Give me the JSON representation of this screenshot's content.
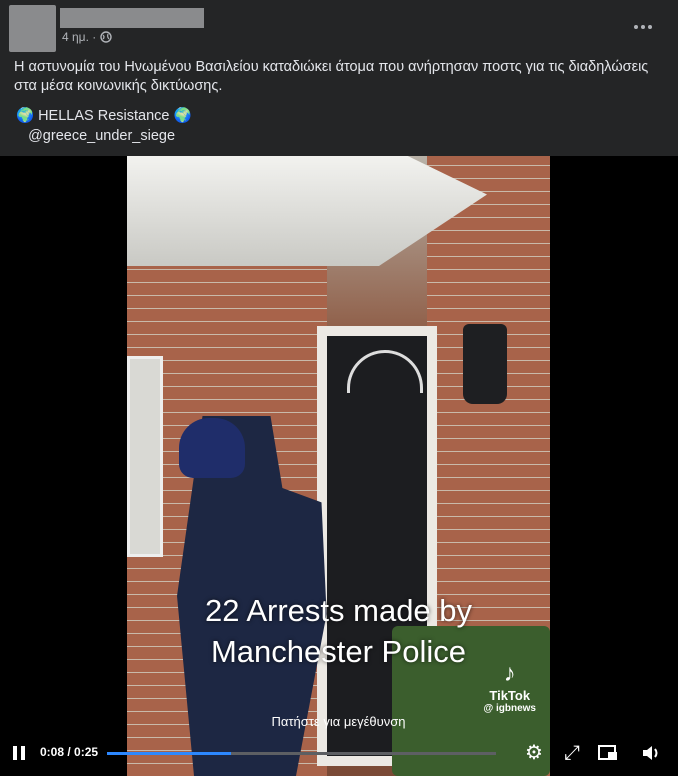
{
  "post": {
    "time": "4 ημ. ·",
    "text": "Η αστυνομία του Ηνωμένου Βασιλείου καταδιώκει άτομα που ανήρτησαν ποστς για τις διαδηλώσεις στα μέσα κοινωνικής δικτύωσης.",
    "sig_line1": "🌍 HELLAS Resistance 🌍",
    "sig_line2": "   @greece_under_siege"
  },
  "video": {
    "caption_line1": "22 Arrests made by",
    "caption_line2": "Manchester Police",
    "tiktok_label": "TikTok",
    "tiktok_handle": "@ igbnews",
    "tap_hint": "Πατήστε για μεγέθυνση",
    "current_time": "0:08",
    "duration": "0:25",
    "time_display": "0:08 / 0:25",
    "progress_fraction": 0.32
  },
  "icons": {
    "privacy": "globe-icon",
    "more": "more-options-icon",
    "pause": "pause-icon",
    "settings": "gear-icon",
    "fullscreen": "fullscreen-icon",
    "pip": "picture-in-picture-icon",
    "volume": "volume-icon"
  }
}
